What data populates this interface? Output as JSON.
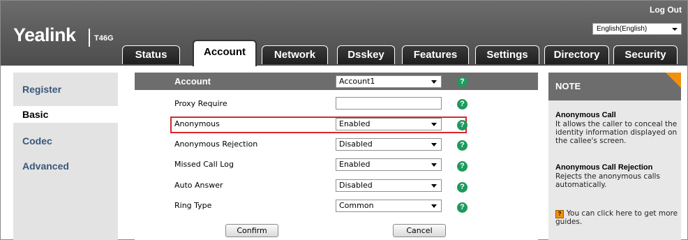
{
  "header": {
    "logo_text": "Yealink",
    "model": "T46G",
    "logout_label": "Log Out",
    "language_selected": "English(English)"
  },
  "tabs": [
    {
      "label": "Status"
    },
    {
      "label": "Account",
      "active": true
    },
    {
      "label": "Network"
    },
    {
      "label": "Dsskey"
    },
    {
      "label": "Features"
    },
    {
      "label": "Settings"
    },
    {
      "label": "Directory"
    },
    {
      "label": "Security"
    }
  ],
  "sidebar": {
    "items": [
      {
        "label": "Register"
      },
      {
        "label": "Basic",
        "active": true
      },
      {
        "label": "Codec"
      },
      {
        "label": "Advanced"
      }
    ]
  },
  "form": {
    "rows": [
      {
        "label": "Account",
        "value": "Account1",
        "type": "select"
      },
      {
        "label": "Proxy Require",
        "value": "",
        "type": "text"
      },
      {
        "label": "Anonymous",
        "value": "Enabled",
        "type": "select",
        "highlighted": true
      },
      {
        "label": "Anonymous Rejection",
        "value": "Disabled",
        "type": "select"
      },
      {
        "label": "Missed Call Log",
        "value": "Enabled",
        "type": "select"
      },
      {
        "label": "Auto Answer",
        "value": "Disabled",
        "type": "select"
      },
      {
        "label": "Ring Type",
        "value": "Common",
        "type": "select"
      }
    ],
    "help_glyph": "?",
    "confirm_label": "Confirm",
    "cancel_label": "Cancel",
    "highlight_color": "#d8262c"
  },
  "note": {
    "title": "NOTE",
    "sections": [
      {
        "heading": "Anonymous Call",
        "text": "It allows the caller to conceal the identity information displayed on the callee's screen."
      },
      {
        "heading": "Anonymous Call Rejection",
        "text": "Rejects the anonymous calls automatically."
      }
    ],
    "guide_text": "You can click here to get more guides.",
    "guide_icon_glyph": "?"
  },
  "colors": {
    "header_bg": "#5a5a5a",
    "help_icon": "#1e9a5c",
    "note_corner": "#f0900d",
    "nav_text": "#38587a"
  }
}
